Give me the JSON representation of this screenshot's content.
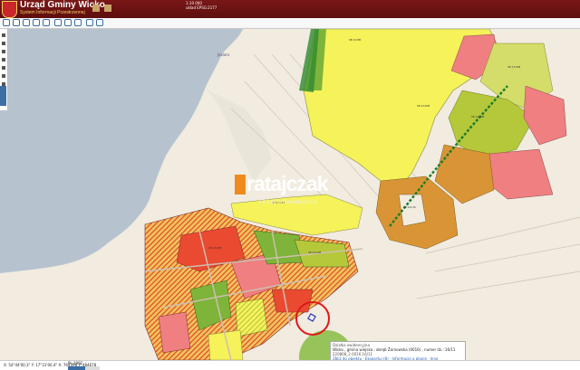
{
  "header": {
    "title": "Urząd Gminy Wicko",
    "subtitle": "System Informacji Przestrzennej",
    "scale_text": "1:10 000",
    "scale_sub": "układ EPSG:2177"
  },
  "toolbar": {
    "icons": [
      "zoom-in-icon",
      "zoom-out-icon",
      "pan-icon",
      "info-icon",
      "measure-icon",
      "print-icon",
      "layers-icon",
      "search-icon"
    ]
  },
  "map": {
    "lake_label": "Jezioro",
    "parcel_labels": [
      "SE.10.ER",
      "SE.10.RM",
      "SE.10.MN",
      "SE.10.US",
      "SE.13.RM",
      "SE.14.RM",
      "SE.15.RM",
      "SE.16.RM"
    ]
  },
  "watermark": {
    "brand": "ratajczak",
    "brand_small": "nieruchomości",
    "tagline": "14 Lat doświadczenia"
  },
  "popup": {
    "heading": "Działka ewidencyjna",
    "line1": "Wicko , gmina wiejska , obręb Żarnowska (0016) , numer dz.: 16/11",
    "line2": "220808_2.0016.16/11",
    "links": "Zbliż do obiektu · Eksportuj (8) · Informacje o planie · Inne"
  },
  "footer": {
    "coords_x": "X: 54°44'00.3\"",
    "coords_y": "Y: 17°31'00.4\"",
    "extra1": "X: 764398",
    "extra2": "Y: 484678",
    "zoom_label": "PL-1992",
    "zoom_level": 0.55
  },
  "colors": {
    "header_bg": "#6d1212",
    "mn_yellow": "#f5f25a",
    "rm_olive": "#b5c83a",
    "us_orange": "#d99535",
    "u_red": "#e94a30",
    "zp_pink": "#ef7f80",
    "forest_green": "#7eb43a"
  }
}
